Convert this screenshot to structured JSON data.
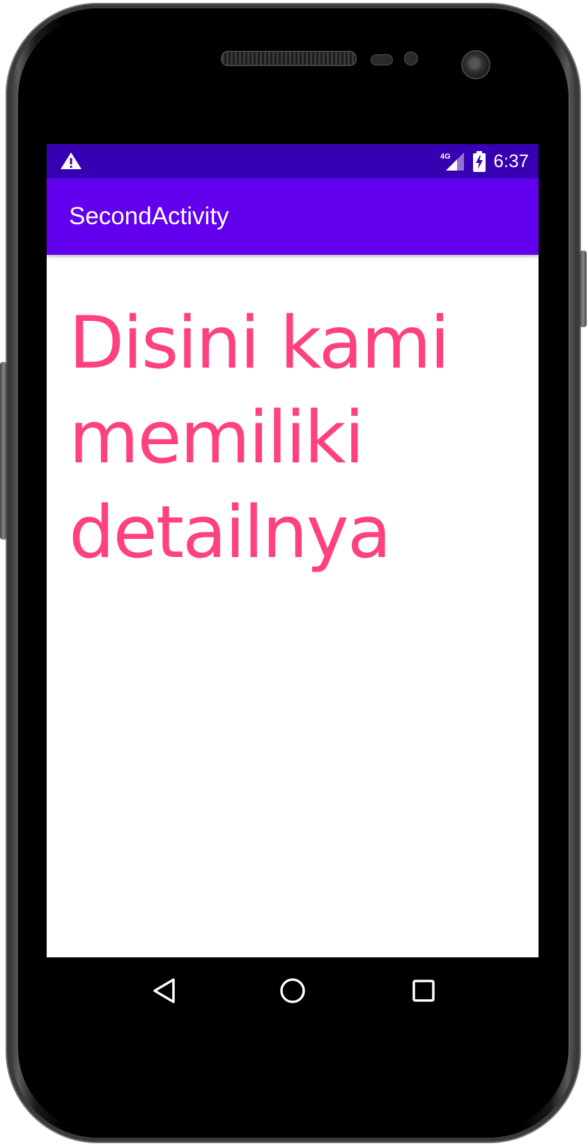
{
  "status_bar": {
    "warning_icon": "warning-icon",
    "network_label": "4G",
    "signal_icon": "signal-icon",
    "battery_icon": "battery-charging-icon",
    "time": "6:37"
  },
  "app_bar": {
    "title": "SecondActivity"
  },
  "content": {
    "detail_text": "Disini kami memiliki detailnya"
  },
  "nav_bar": {
    "back_icon": "back-triangle-icon",
    "home_icon": "home-circle-icon",
    "recents_icon": "recents-square-icon"
  },
  "colors": {
    "status_bar": "#3700b3",
    "app_bar": "#6200ee",
    "detail_text": "#ff4081"
  }
}
